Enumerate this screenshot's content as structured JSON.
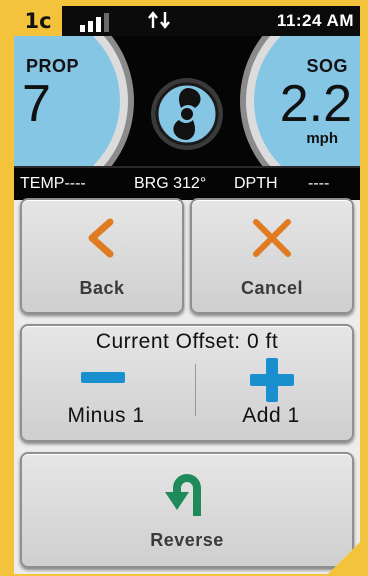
{
  "figure_label": "1c",
  "status_bar": {
    "time": "11:24 AM",
    "signal_icon": "signal-bars-icon",
    "data_icon": "up-down-arrows-icon"
  },
  "gauges": {
    "prop": {
      "label": "PROP",
      "value": "7"
    },
    "sog": {
      "label": "SOG",
      "value": "2.2",
      "unit": "mph"
    },
    "center_icon": "motor-logo-icon"
  },
  "readouts": {
    "temp": "TEMP----",
    "brg": "BRG 312°",
    "dpth_label": "DPTH",
    "dpth_value": "----"
  },
  "buttons": {
    "back": {
      "label": "Back",
      "icon": "chevron-left-icon"
    },
    "cancel": {
      "label": "Cancel",
      "icon": "x-icon"
    },
    "offset": {
      "title": "Current Offset: 0 ft",
      "minus": {
        "label": "Minus 1",
        "icon": "minus-icon"
      },
      "add": {
        "label": "Add 1",
        "icon": "plus-icon"
      }
    },
    "reverse": {
      "label": "Reverse",
      "icon": "u-turn-icon"
    }
  },
  "colors": {
    "accent_orange": "#e07b22",
    "accent_blue": "#1a8fce",
    "accent_green": "#1f8a5a",
    "gauge_blue": "#86c6e5",
    "frame_yellow": "#f3c33b"
  }
}
